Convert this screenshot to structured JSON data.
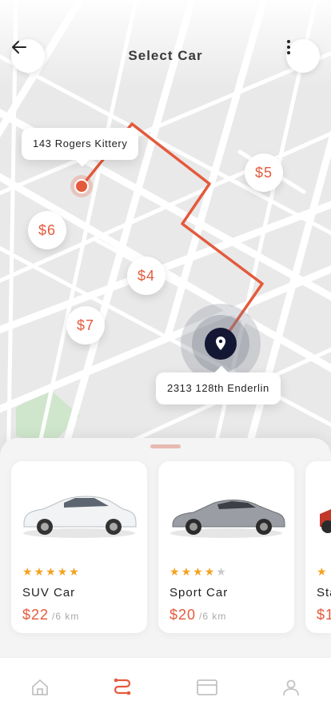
{
  "header": {
    "title": "Select Car",
    "back_icon": "arrow-left-icon",
    "menu_icon": "more-vertical-icon"
  },
  "map": {
    "origin_label": "143 Rogers Kittery",
    "destination_label": "2313 128th Enderlin",
    "route_color": "#e45a3c",
    "prices": [
      "$5",
      "$6",
      "$4",
      "$7"
    ]
  },
  "cars": [
    {
      "name": "SUV Car",
      "price": "$22",
      "unit": "/6 km",
      "rating": 5
    },
    {
      "name": "Sport Car",
      "price": "$20",
      "unit": "/6 km",
      "rating": 4
    },
    {
      "name": "Sta",
      "price": "$1",
      "unit": "",
      "rating": 1
    }
  ],
  "nav": {
    "items": [
      "home-icon",
      "route-icon",
      "card-icon",
      "profile-icon"
    ],
    "active": "route-icon",
    "accent": "#e45a3c"
  }
}
